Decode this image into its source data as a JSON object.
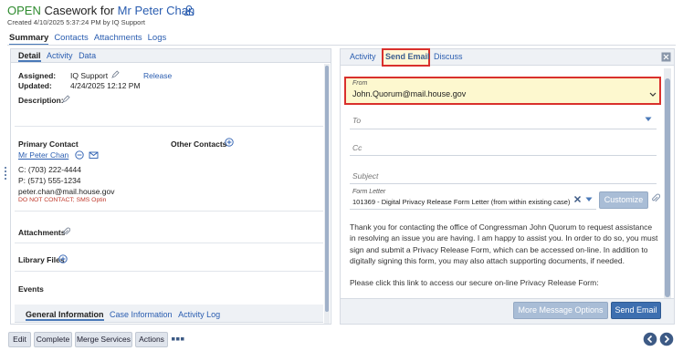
{
  "header": {
    "status": "OPEN",
    "title_prefix": "Casework for",
    "person": "Mr Peter Chan",
    "created": "Created 4/10/2025 5:37:24 PM by IQ Support"
  },
  "main_tabs": [
    "Summary",
    "Contacts",
    "Attachments",
    "Logs"
  ],
  "left": {
    "tabs": [
      "Detail",
      "Activity",
      "Data"
    ],
    "assigned_label": "Assigned:",
    "assigned_value": "IQ Support",
    "release_link": "Release",
    "updated_label": "Updated:",
    "updated_value": "4/24/2025 12:12 PM",
    "description_label": "Description:",
    "primary_contact_label": "Primary Contact",
    "primary_contact_name": "Mr Peter Chan",
    "other_contacts_label": "Other Contacts",
    "phone_c": "C: (703) 222-4444",
    "phone_p": "P: (571) 555-1234",
    "email": "peter.chan@mail.house.gov",
    "dnc": "DO NOT CONTACT; SMS Optin",
    "attachments_label": "Attachments",
    "library_label": "Library Files",
    "events_label": "Events",
    "bottom_tabs": [
      "General Information",
      "Case Information",
      "Activity Log"
    ]
  },
  "right": {
    "tabs": [
      "Activity",
      "Send Email",
      "Discuss"
    ],
    "from_label": "From",
    "from_value": "John.Quorum@mail.house.gov",
    "to_placeholder": "To",
    "cc_placeholder": "Cc",
    "subject_placeholder": "Subject",
    "form_letter_label": "Form Letter",
    "form_letter_value": "101369 - Digital Privacy Release Form Letter (from within existing case)",
    "customize_label": "Customize",
    "body_p1": "Thank you for contacting the office of Congressman John Quorum to request assistance in resolving an issue you are having.  I am happy to assist you.  In order to do so, you must sign and submit a Privacy Release Form, which can be accessed on-line.  In addition to digitally signing this form, you may also attach supporting documents, if needed.",
    "body_p2": "Please click this link to access our secure on-line Privacy Release Form:",
    "more_options_label": "More Message Options",
    "send_label": "Send Email"
  },
  "footer_buttons": [
    "Edit",
    "Complete",
    "Merge Services",
    "Actions"
  ],
  "colors": {
    "accent": "#2a5db0",
    "open_green": "#2e8b2e",
    "highlight_red": "#d9302c",
    "field_yellow": "#fdf8cf",
    "send_blue": "#3d6fb0"
  },
  "icons": [
    "person-icon",
    "pencil-icon",
    "clip-icon",
    "plus-circle-icon",
    "minus-circle-icon",
    "email-icon",
    "close-icon",
    "chevron-down-icon",
    "circle-arrow-left-icon",
    "circle-arrow-right-icon"
  ]
}
